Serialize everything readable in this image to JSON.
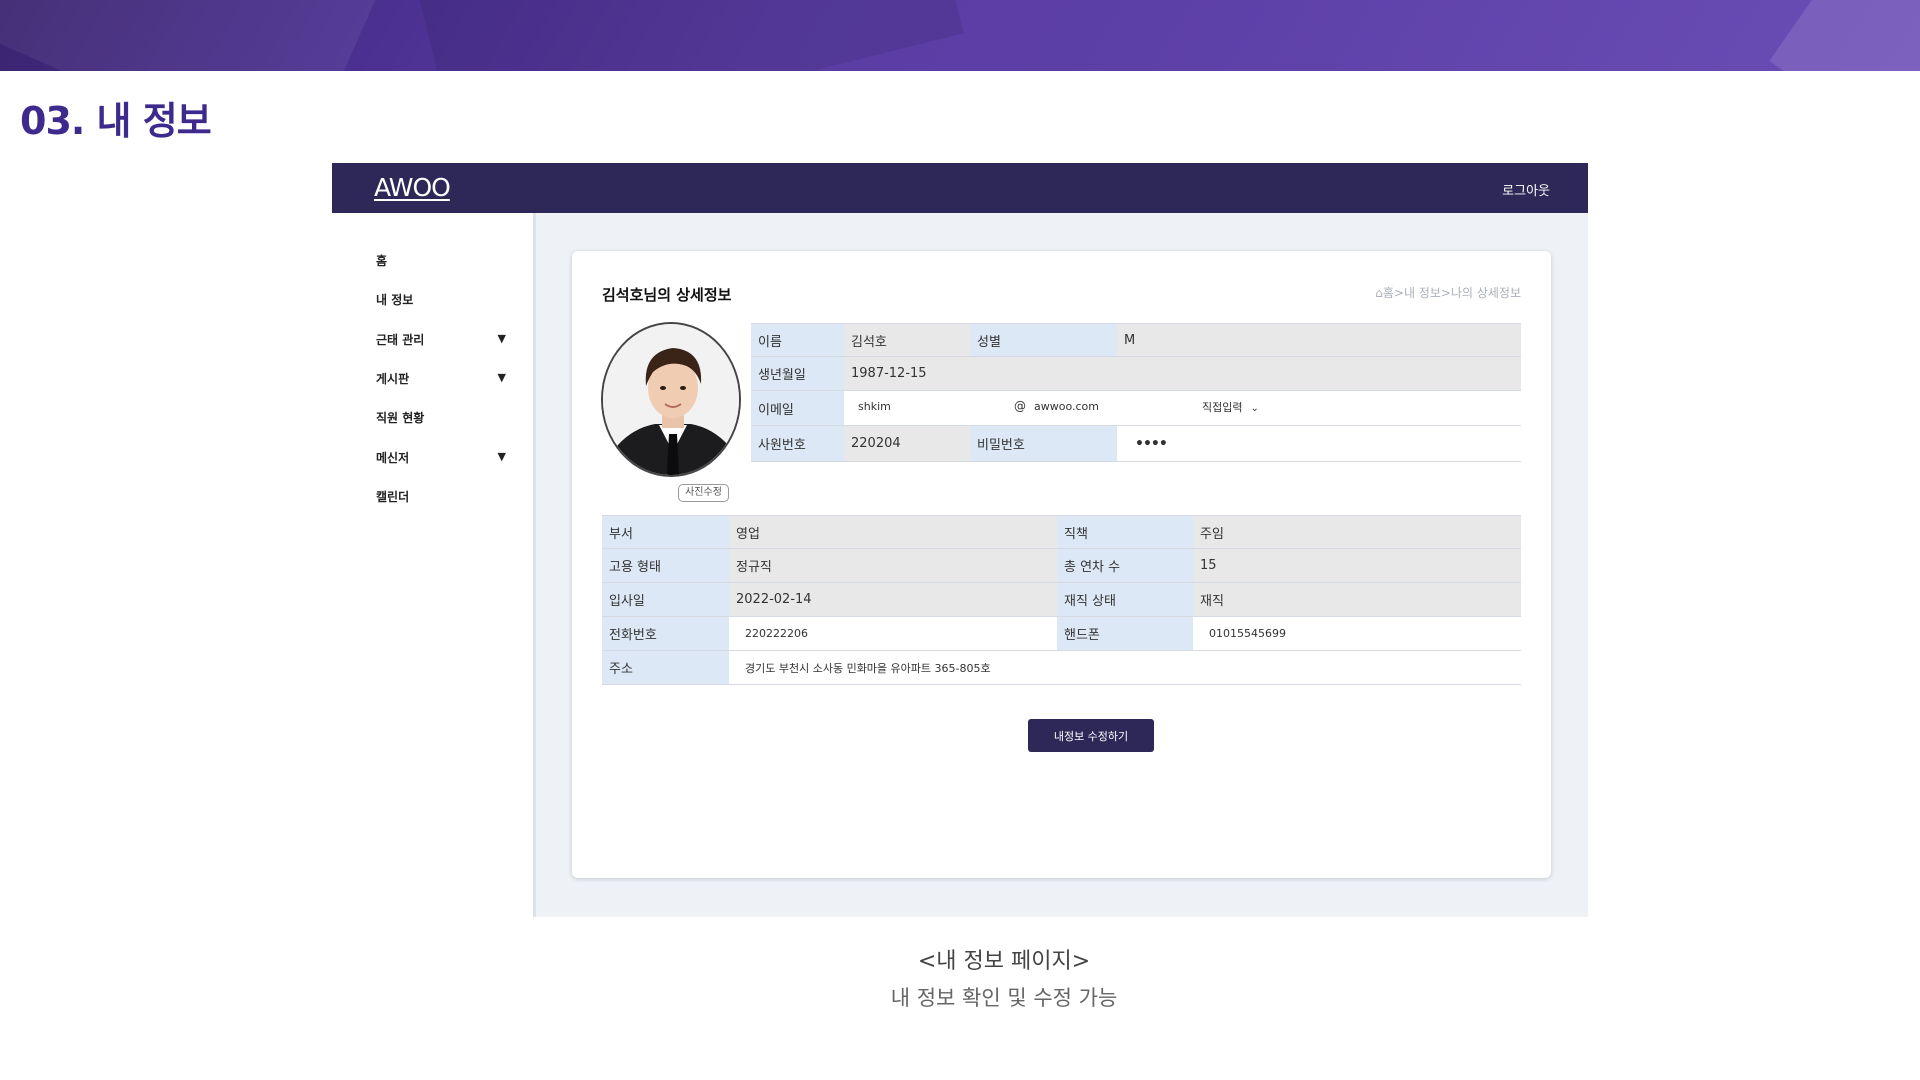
{
  "slide": {
    "title": "03. 내 정보",
    "caption": "<내 정보 페이지>",
    "subcaption": "내 정보 확인 및 수정 가능"
  },
  "app": {
    "logo": "AWOO",
    "logout": "로그아웃",
    "sidebar": [
      {
        "label": "홈",
        "has_arrow": false
      },
      {
        "label": "내 정보",
        "has_arrow": false
      },
      {
        "label": "근태 관리",
        "has_arrow": true
      },
      {
        "label": "게시판",
        "has_arrow": true
      },
      {
        "label": "직원 현황",
        "has_arrow": false
      },
      {
        "label": "메신저",
        "has_arrow": true
      },
      {
        "label": "캘린더",
        "has_arrow": false
      }
    ],
    "arrow_glyph": "▼",
    "card": {
      "title": "김석호님의 상세정보",
      "breadcrumb": "⌂홈>내 정보>나의 상세정보",
      "photo_button": "사진수정",
      "top_fields": {
        "name_label": "이름",
        "name": "김석호",
        "gender_label": "성별",
        "gender": "M",
        "birth_label": "생년월일",
        "birth": "1987-12-15",
        "email_label": "이메일",
        "email_id": "shkim",
        "email_at": "@",
        "email_domain": "awwoo.com",
        "email_select": "직접입력",
        "empno_label": "사원번호",
        "empno": "220204",
        "password_label": "비밀번호",
        "password": "••••"
      },
      "bottom_fields": {
        "dept_label": "부서",
        "dept": "영업",
        "position_label": "직책",
        "position": "주임",
        "employment_label": "고용 형태",
        "employment": "정규직",
        "leave_label": "총 연차 수",
        "leave": "15",
        "join_label": "입사일",
        "join": "2022-02-14",
        "status_label": "재직 상태",
        "status": "재직",
        "phone_label": "전화번호",
        "phone": "220222206",
        "mobile_label": "핸드폰",
        "mobile": "01015545699",
        "address_label": "주소",
        "address": "경기도 부천시 소사동 민화마을 유아파트 365-805호"
      },
      "edit_button": "내정보 수정하기"
    }
  },
  "colors": {
    "brand_navy": "#2d2858",
    "title_purple": "#3e2a8c",
    "label_bg": "#dce8f5",
    "value_bg": "#e8e8e8"
  }
}
